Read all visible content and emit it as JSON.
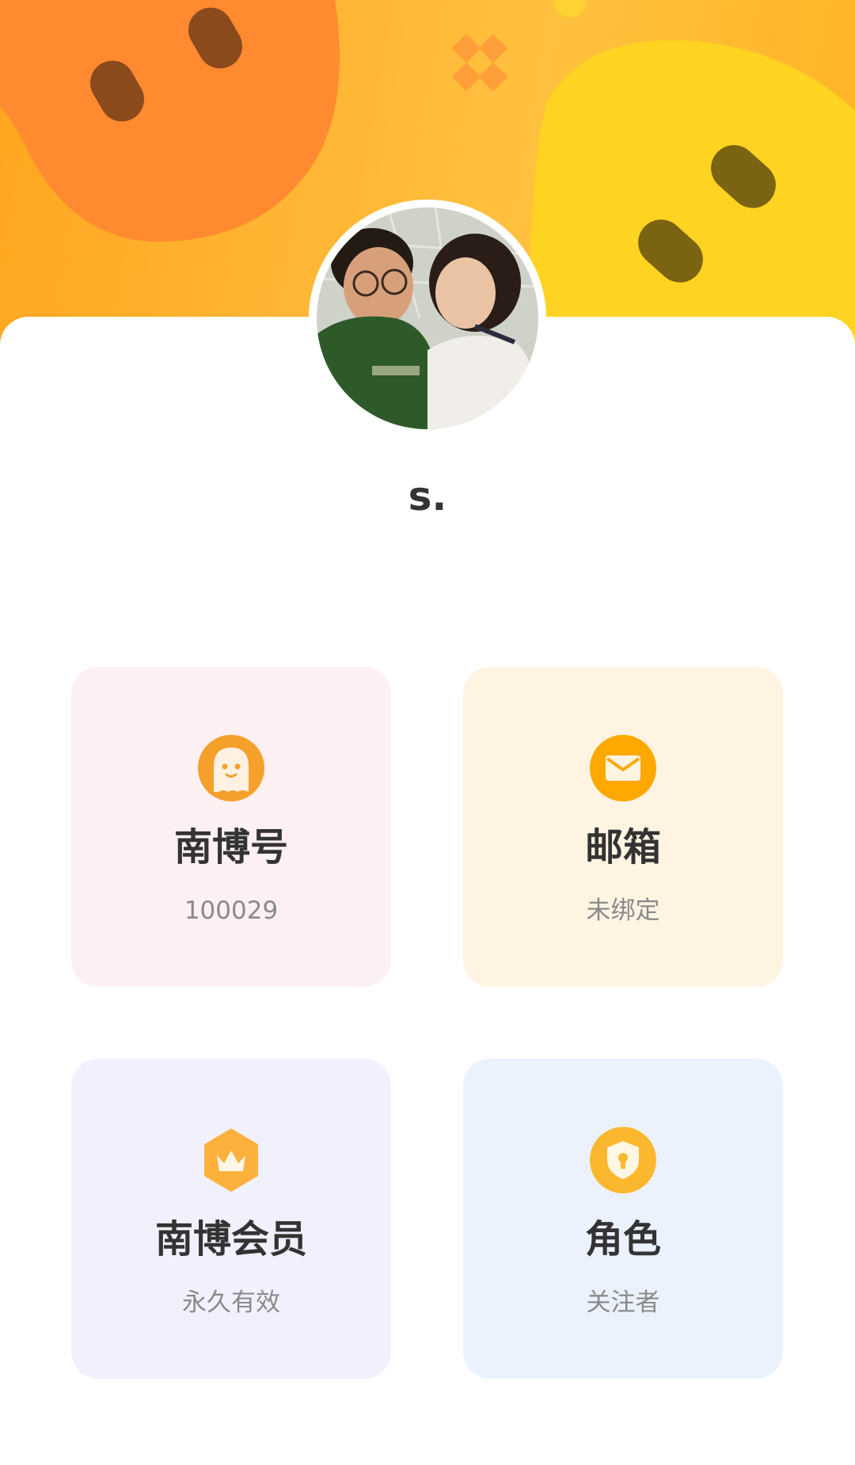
{
  "profile": {
    "username": "s.",
    "avatar_description": "avatar-photo"
  },
  "cards": {
    "nanbo_id": {
      "title": "南博号",
      "value": "100029",
      "icon": "ghost-face-icon",
      "background": "#fdf0f2",
      "icon_color": "#f5a623"
    },
    "email": {
      "title": "邮箱",
      "value": "未绑定",
      "icon": "mail-icon",
      "background": "#fff4e2",
      "icon_color": "#ffa800"
    },
    "membership": {
      "title": "南博会员",
      "value": "永久有效",
      "icon": "crown-hexagon-icon",
      "background": "#f1f0fd",
      "icon_color": "#fbb13c"
    },
    "role": {
      "title": "角色",
      "value": "关注者",
      "icon": "shield-lock-icon",
      "background": "#ebf2fd",
      "icon_color": "#fbb82e"
    }
  },
  "colors": {
    "banner_orange": "#ffa51f",
    "banner_left_blob": "#ff8a30",
    "banner_right_blob": "#ffd321",
    "text_primary": "#333333",
    "text_secondary": "#8a8a8a"
  }
}
